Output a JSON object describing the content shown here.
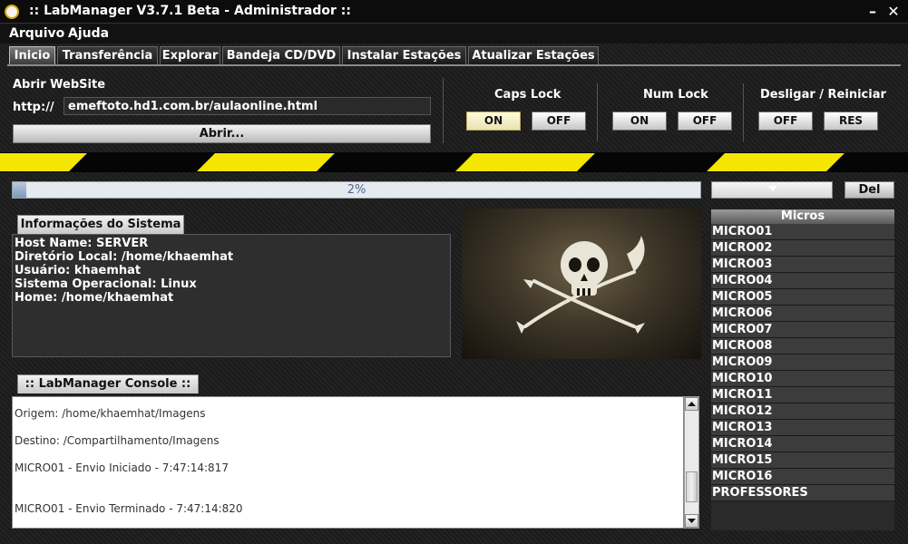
{
  "window": {
    "title": ":: LabManager V3.7.1 Beta - Administrador ::",
    "minimize": "–",
    "close": "✕"
  },
  "menu": [
    "Arquivo",
    "Ajuda"
  ],
  "tabs": [
    "Inicio",
    "Transferência",
    "Explorar",
    "Bandeja CD/DVD",
    "Instalar Estações",
    "Atualizar Estações"
  ],
  "website": {
    "label": "Abrir WebSite",
    "prefix": "http://",
    "url": "emeftoto.hd1.com.br/aulaonline.html",
    "open_button": "Abrir..."
  },
  "caps_lock": {
    "label": "Caps Lock",
    "on": "ON",
    "off": "OFF"
  },
  "num_lock": {
    "label": "Num Lock",
    "on": "ON",
    "off": "OFF"
  },
  "power": {
    "label": "Desligar / Reiniciar",
    "off": "OFF",
    "restart": "RES"
  },
  "progress": {
    "value": 0.02,
    "text": "2%"
  },
  "del_button": "Del",
  "system_info": {
    "tab": "Informações do Sistema",
    "lines": [
      "Host Name: SERVER",
      "Diretório Local: /home/khaemhat",
      "Usuário: khaemhat",
      "Sistema Operacional: Linux",
      "Home: /home/khaemhat"
    ]
  },
  "console": {
    "tab": "::  LabManager Console  ::",
    "lines": [
      "Origem: /home/khaemhat/Imagens",
      "Destino: /Compartilhamento/Imagens",
      "MICRO01 - Envio Iniciado - 7:47:14:817",
      "MICRO01 - Envio Terminado - 7:47:14:820"
    ]
  },
  "micros": {
    "header": "Micros",
    "items": [
      "MICRO01",
      "MICRO02",
      "MICRO03",
      "MICRO04",
      "MICRO05",
      "MICRO06",
      "MICRO07",
      "MICRO08",
      "MICRO09",
      "MICRO10",
      "MICRO11",
      "MICRO12",
      "MICRO13",
      "MICRO14",
      "MICRO15",
      "MICRO16",
      "PROFESSORES"
    ]
  },
  "image": {
    "icon": "jolly-roger-flag-icon"
  },
  "colors": {
    "hazard_yellow": "#f4e600",
    "background": "#1e1e1e",
    "progress_fill": "#7e98bc"
  }
}
